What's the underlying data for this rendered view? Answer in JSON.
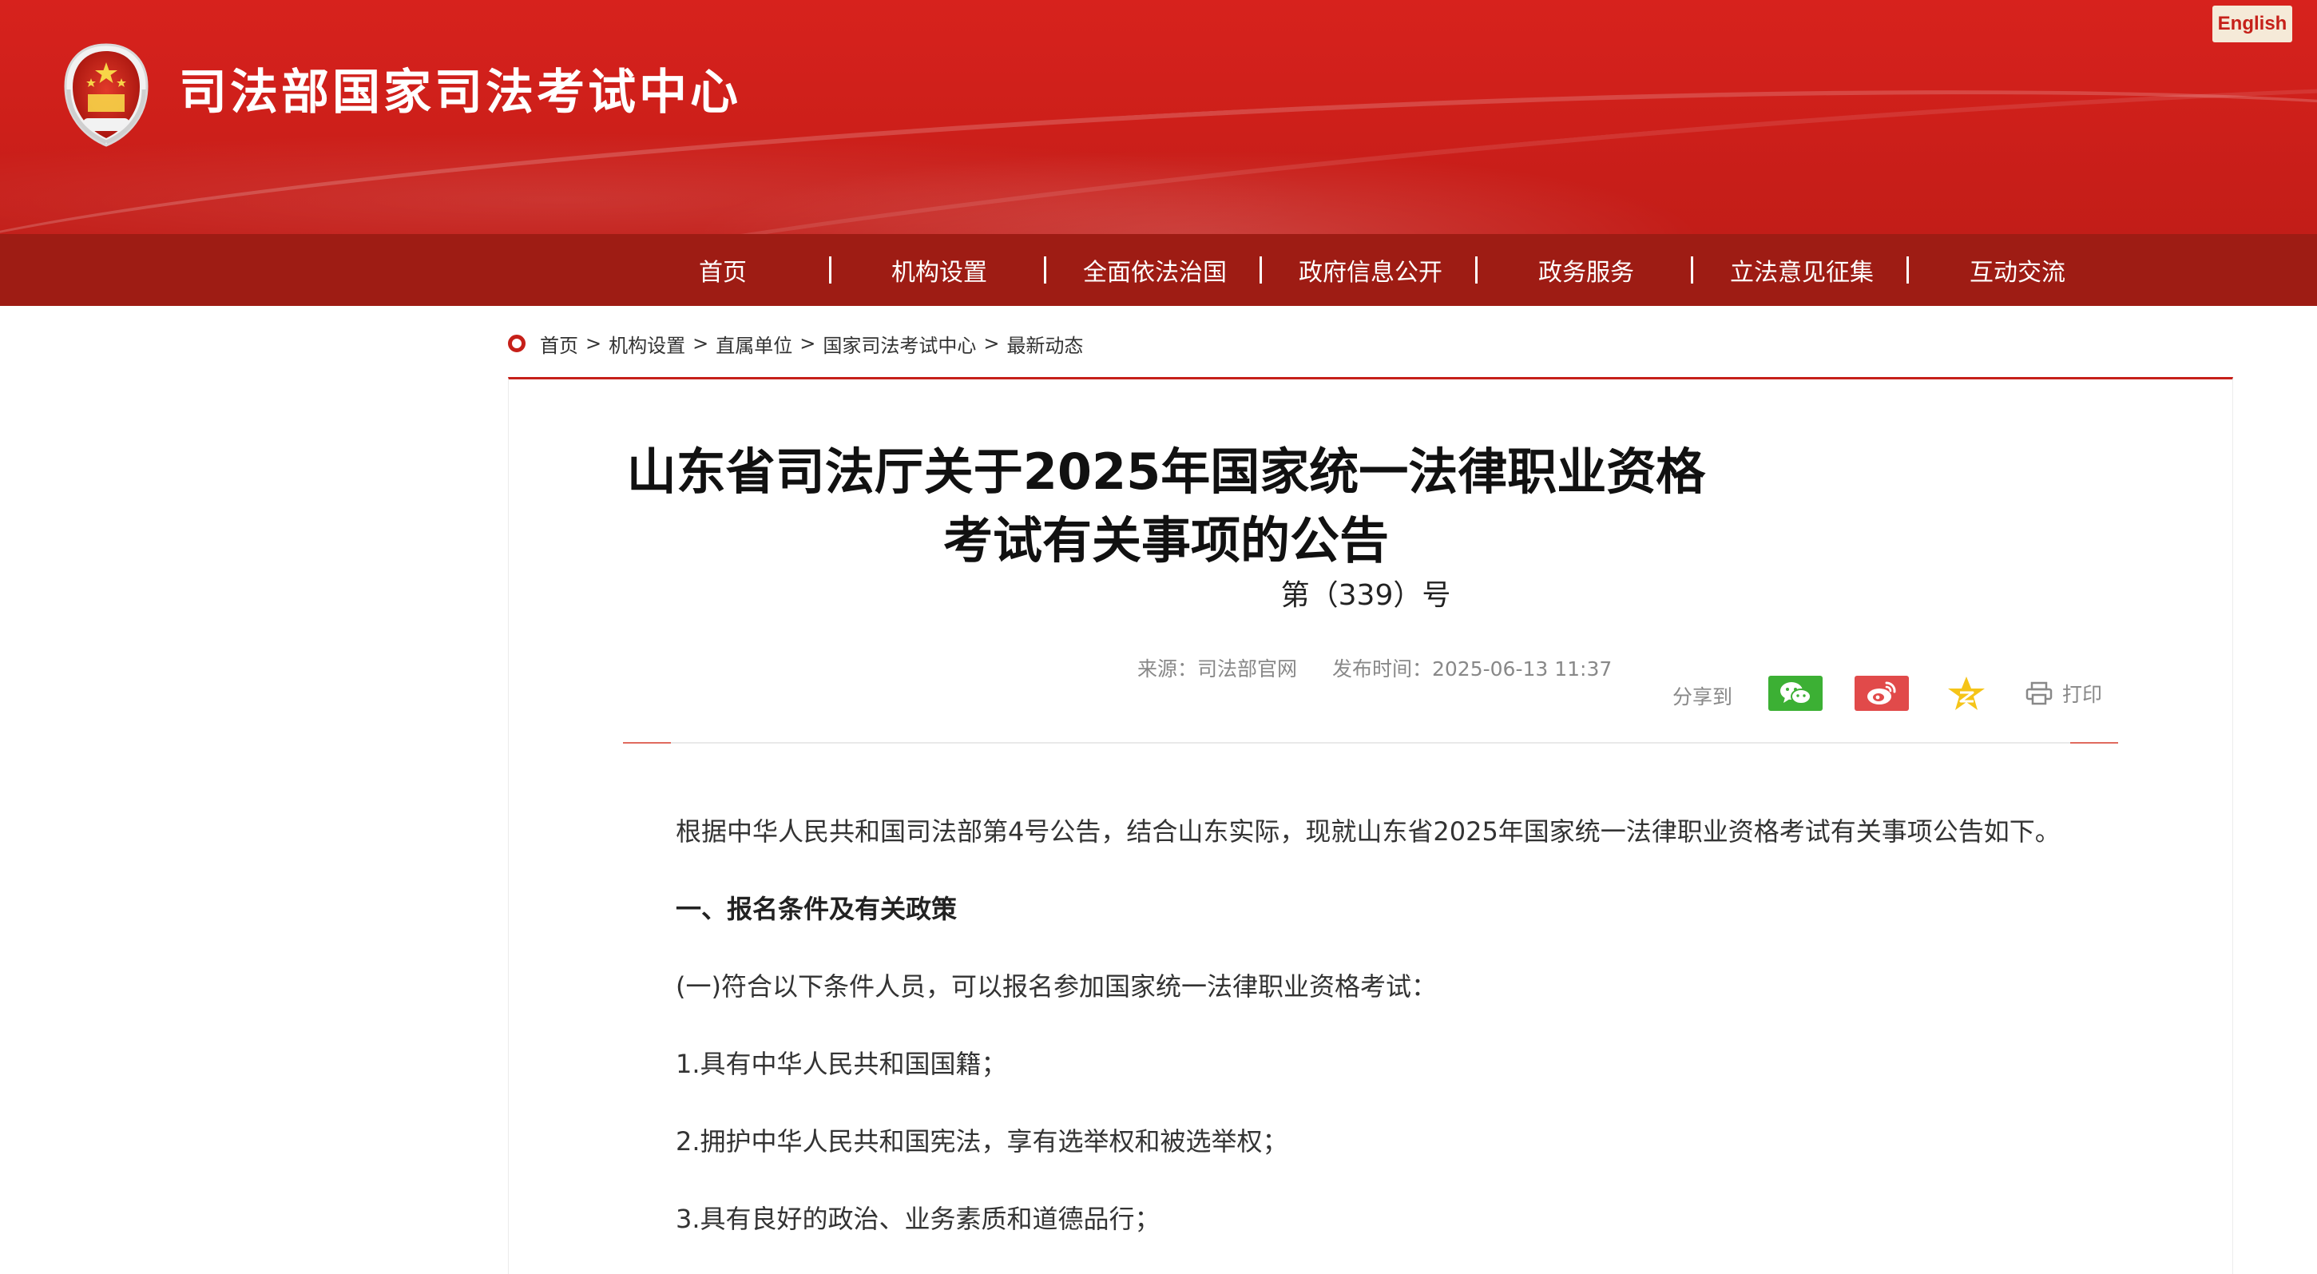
{
  "header": {
    "site_title": "司法部国家司法考试中心",
    "english_label": "English",
    "emblem_icon": "national-emblem-icon",
    "brand_color": "#c62019",
    "nav_color": "#9e1c14"
  },
  "nav": {
    "items": [
      "首页",
      "机构设置",
      "全面依法治国",
      "政府信息公开",
      "政务服务",
      "立法意见征集",
      "互动交流"
    ]
  },
  "breadcrumb": {
    "items": [
      "首页",
      "机构设置",
      "直属单位",
      "国家司法考试中心",
      "最新动态"
    ],
    "separator": ">"
  },
  "article": {
    "title": "山东省司法厅关于2025年国家统一法律职业资格考试有关事项的公告",
    "doc_number": "第（339）号",
    "source": "来源：司法部官网",
    "publish_time": "发布时间：2025-06-13 11:37",
    "share_label": "分享到",
    "share_icons": [
      "wechat-icon",
      "weibo-icon",
      "qzone-icon"
    ],
    "print_label": "打印",
    "paragraphs": [
      {
        "text": "根据中华人民共和国司法部第4号公告，结合山东实际，现就山东省2025年国家统一法律职业资格考试有关事项公告如下。",
        "bold": false
      },
      {
        "text": "一、报名条件及有关政策",
        "bold": true
      },
      {
        "text": "(一)符合以下条件人员，可以报名参加国家统一法律职业资格考试：",
        "bold": false
      },
      {
        "text": "1.具有中华人民共和国国籍；",
        "bold": false
      },
      {
        "text": "2.拥护中华人民共和国宪法，享有选举权和被选举权；",
        "bold": false
      },
      {
        "text": "3.具有良好的政治、业务素质和道德品行；",
        "bold": false
      }
    ]
  }
}
